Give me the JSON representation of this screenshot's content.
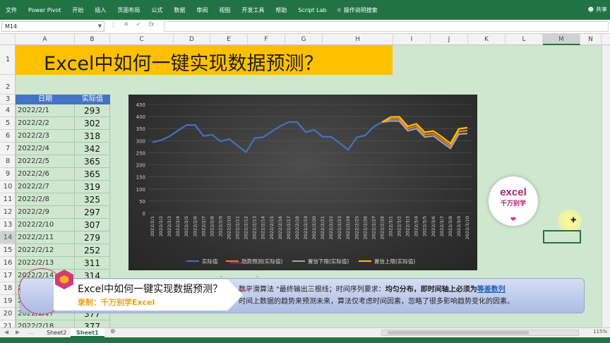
{
  "ribbon": {
    "tabs": [
      "文件",
      "Power Pivot",
      "开始",
      "插入",
      "页面布局",
      "公式",
      "数据",
      "审阅",
      "视图",
      "开发工具",
      "帮助",
      "Script Lab"
    ],
    "tell_me": "操作说明搜索",
    "share": "共享"
  },
  "formula_bar": {
    "name_box": "M14",
    "formula": ""
  },
  "columns": [
    "A",
    "B",
    "C",
    "D",
    "E",
    "F",
    "G",
    "H",
    "I",
    "J",
    "K",
    "L",
    "M",
    "N"
  ],
  "selected_column": "M",
  "rows": [
    "1",
    "2",
    "3",
    "4",
    "5",
    "6",
    "7",
    "8",
    "9",
    "10",
    "11",
    "12",
    "13",
    "14",
    "15",
    "16",
    "17",
    "18",
    "19",
    "20",
    "21"
  ],
  "selected_row": "14",
  "sheet": {
    "title": "Excel中如何一键实现数据预测？",
    "table_headers": {
      "date": "日期",
      "value": "实际值"
    },
    "table_rows": [
      {
        "date": "2022/2/1",
        "value": "293"
      },
      {
        "date": "2022/2/2",
        "value": "302"
      },
      {
        "date": "2022/2/3",
        "value": "318"
      },
      {
        "date": "2022/2/4",
        "value": "342"
      },
      {
        "date": "2022/2/5",
        "value": "365"
      },
      {
        "date": "2022/2/6",
        "value": "365"
      },
      {
        "date": "2022/2/7",
        "value": "319"
      },
      {
        "date": "2022/2/8",
        "value": "325"
      },
      {
        "date": "2022/2/9",
        "value": "297"
      },
      {
        "date": "2022/2/10",
        "value": "307"
      },
      {
        "date": "2022/2/11",
        "value": "279"
      },
      {
        "date": "2022/2/12",
        "value": "252"
      },
      {
        "date": "2022/2/13",
        "value": "311"
      },
      {
        "date": "2022/2/14",
        "value": "314"
      },
      {
        "date": "2022/2/15",
        "value": ""
      },
      {
        "date": "2022/2/16",
        "value": ""
      },
      {
        "date": "2022/2/17",
        "value": "377"
      },
      {
        "date": "2022/2/18",
        "value": "377"
      }
    ]
  },
  "chart_data": {
    "type": "line",
    "x": [
      "2022/2/1",
      "2022/2/2",
      "2022/2/3",
      "2022/2/4",
      "2022/2/5",
      "2022/2/6",
      "2022/2/7",
      "2022/2/8",
      "2022/2/9",
      "2022/2/10",
      "2022/2/11",
      "2022/2/12",
      "2022/2/13",
      "2022/2/14",
      "2022/2/15",
      "2022/2/16",
      "2022/2/17",
      "2022/2/18",
      "2022/2/19",
      "2022/2/20",
      "2022/2/21",
      "2022/2/22",
      "2022/2/23",
      "2022/2/24",
      "2022/2/25",
      "2022/2/26",
      "2022/2/27",
      "2022/2/28",
      "2022/3/1",
      "2022/3/2",
      "2022/3/3",
      "2022/3/4",
      "2022/3/5",
      "2022/3/6",
      "2022/3/7",
      "2022/3/8",
      "2022/3/9",
      "2022/3/10"
    ],
    "ylim": [
      0,
      450
    ],
    "yticks": [
      0,
      50,
      100,
      150,
      200,
      250,
      300,
      350,
      400,
      450
    ],
    "series": [
      {
        "name": "实际值",
        "color": "#4472c4",
        "values": [
          293,
          302,
          318,
          342,
          365,
          365,
          319,
          325,
          297,
          307,
          279,
          252,
          311,
          314,
          338,
          360,
          377,
          377,
          335,
          345,
          316,
          316,
          290,
          262,
          314,
          322,
          358,
          377,
          null,
          null,
          null,
          null,
          null,
          null,
          null,
          null,
          null,
          null
        ]
      },
      {
        "name": "趋势预测(实际值)",
        "color": "#ed7d31",
        "values": [
          null,
          null,
          null,
          null,
          null,
          null,
          null,
          null,
          null,
          null,
          null,
          null,
          null,
          null,
          null,
          null,
          null,
          null,
          null,
          null,
          null,
          null,
          null,
          null,
          null,
          null,
          null,
          377,
          390,
          390,
          350,
          360,
          325,
          330,
          305,
          278,
          338,
          342
        ]
      },
      {
        "name": "置信下限(实际值)",
        "color": "#a5a5a5",
        "values": [
          null,
          null,
          null,
          null,
          null,
          null,
          null,
          null,
          null,
          null,
          null,
          null,
          null,
          null,
          null,
          null,
          null,
          null,
          null,
          null,
          null,
          null,
          null,
          null,
          null,
          null,
          null,
          377,
          382,
          381,
          341,
          350,
          315,
          320,
          294,
          268,
          327,
          330
        ]
      },
      {
        "name": "置信上限(实际值)",
        "color": "#ffc000",
        "values": [
          null,
          null,
          null,
          null,
          null,
          null,
          null,
          null,
          null,
          null,
          null,
          null,
          null,
          null,
          null,
          null,
          null,
          null,
          null,
          null,
          null,
          null,
          null,
          null,
          null,
          null,
          null,
          377,
          398,
          399,
          359,
          370,
          335,
          340,
          316,
          288,
          349,
          354
        ]
      }
    ],
    "legend": "bottom",
    "grid": true
  },
  "logo": {
    "line1": "excel",
    "line2": "千万别学",
    "heart": "❤"
  },
  "subtitle": {
    "brand_title": "Excel中如何一键实现数据预测？",
    "brand_sub": "录制：千万别学Excel",
    "line1_prefix": "数平滑算法 \"最终输出三根线；时间序列要求：",
    "line1_bold": "均匀分布，即时间轴上必须为",
    "line1_link": "等差数列",
    "line2": "时间上数据的趋势来预测未来，算法仅考虑时间因素，忽略了很多影响趋势变化的因素。"
  },
  "sheet_tabs": [
    "Sheet2",
    "Sheet1"
  ],
  "active_sheet": "Sheet1",
  "zoom": "115%"
}
